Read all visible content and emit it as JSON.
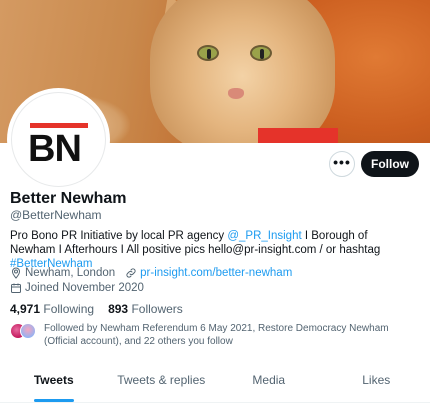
{
  "banner": {
    "accent_color": "#e5332a"
  },
  "avatar": {
    "logo_text": "BN",
    "accent_color": "#e5332a"
  },
  "actions": {
    "more_label": "•••",
    "follow_label": "Follow"
  },
  "profile": {
    "name": "Better Newham",
    "handle": "@BetterNewham",
    "bio": {
      "part1": "Pro Bono PR Initiative by local PR agency ",
      "mention": "@_PR_Insight",
      "part2": " I Borough of Newham I Afterhours I All positive pics hello@pr-insight.com / or hashtag ",
      "hashtag": "#BetterNewham"
    },
    "location": "Newham, London",
    "website": "pr-insight.com/better-newham",
    "joined": "Joined November 2020",
    "following_count": "4,971",
    "following_label": "Following",
    "followers_count": "893",
    "followers_label": "Followers",
    "followed_by": "Followed by Newham Referendum 6 May 2021, Restore Democracy Newham (Official account), and 22 others you follow"
  },
  "tabs": [
    {
      "label": "Tweets",
      "active": true
    },
    {
      "label": "Tweets & replies",
      "active": false
    },
    {
      "label": "Media",
      "active": false
    },
    {
      "label": "Likes",
      "active": false
    }
  ],
  "colors": {
    "link": "#1d9bf0",
    "text": "#0f1419",
    "muted": "#536471",
    "follow_bg": "#0f1419"
  },
  "icons": [
    "location-icon",
    "link-icon",
    "calendar-icon",
    "more-icon"
  ]
}
